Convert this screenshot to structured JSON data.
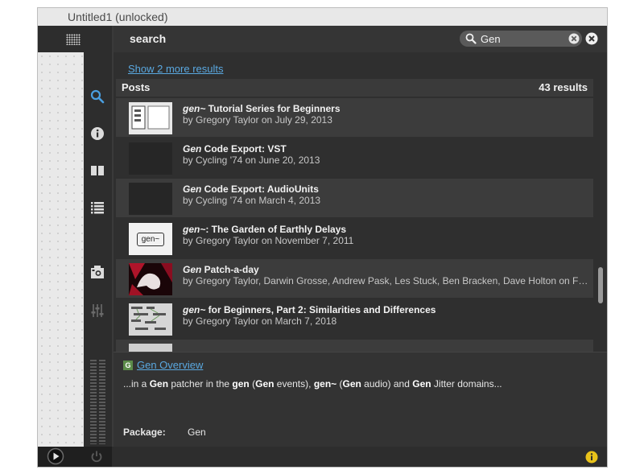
{
  "window": {
    "title": "Untitled1 (unlocked)"
  },
  "search": {
    "label": "search",
    "query": "Gen",
    "placeholder": ""
  },
  "show_more": "Show 2 more results",
  "posts": {
    "header": "Posts",
    "count": "43 results",
    "items": [
      {
        "title_em": "gen~",
        "title_rest": " Tutorial Series for Beginners",
        "byline": "by Gregory Taylor on July 29, 2013",
        "thumb": "diagram"
      },
      {
        "title_em": "Gen",
        "title_rest": " Code Export: VST",
        "byline": "by Cycling '74 on June 20, 2013",
        "thumb": "blank"
      },
      {
        "title_em": "Gen",
        "title_rest": " Code Export: AudioUnits",
        "byline": "by Cycling '74 on March 4, 2013",
        "thumb": "blank"
      },
      {
        "title_em": "gen~",
        "title_rest": ": The Garden of Earthly Delays",
        "byline": "by Gregory Taylor on November 7, 2011",
        "thumb": "gen-box",
        "thumb_text": "gen~"
      },
      {
        "title_em": "Gen",
        "title_rest": " Patch-a-day",
        "byline": "by Gregory Taylor, Darwin Grosse, Andrew Pask, Les Stuck, Ben Bracken, Dave Holton on February ...",
        "thumb": "red"
      },
      {
        "title_em": "gen~",
        "title_rest": " for Beginners, Part 2: Similarities and Differences",
        "byline": "by Gregory Taylor on March 7, 2018",
        "thumb": "patch"
      }
    ]
  },
  "detail": {
    "badge": "G",
    "title": "Gen Overview",
    "desc": [
      {
        "t": "...in a ",
        "b": false
      },
      {
        "t": "Gen",
        "b": true
      },
      {
        "t": " patcher in the ",
        "b": false
      },
      {
        "t": "gen",
        "b": true
      },
      {
        "t": " (",
        "b": false
      },
      {
        "t": "Gen",
        "b": true
      },
      {
        "t": " events), ",
        "b": false
      },
      {
        "t": "gen~",
        "b": true
      },
      {
        "t": " (",
        "b": false
      },
      {
        "t": "Gen",
        "b": true
      },
      {
        "t": " audio) and ",
        "b": false
      },
      {
        "t": "Gen",
        "b": true
      },
      {
        "t": " Jitter domains...",
        "b": false
      }
    ],
    "package_label": "Package:",
    "package_value": "Gen"
  },
  "colors": {
    "accent": "#5aa8e0",
    "info": "#e8c21a",
    "active_icon": "#4a9fe0"
  },
  "icons": [
    "grid-icon",
    "search-icon",
    "info-icon",
    "book-icon",
    "list-icon",
    "snapshot-icon",
    "mixer-icon",
    "play-icon",
    "power-icon",
    "clear-icon",
    "close-icon",
    "info-badge-icon"
  ]
}
